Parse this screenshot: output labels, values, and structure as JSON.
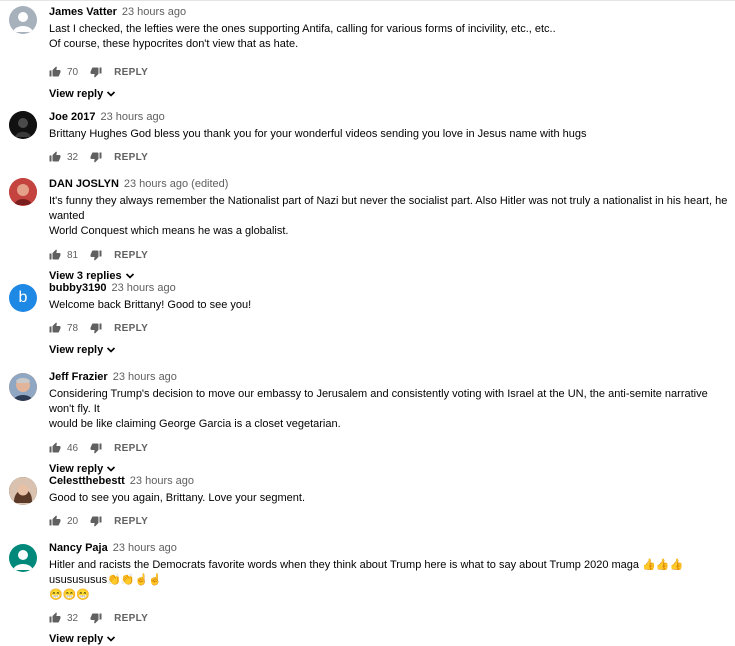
{
  "ui": {
    "reply_label": "REPLY"
  },
  "comments": [
    {
      "author": "James Vatter",
      "time": "23 hours ago",
      "lines": [
        "Last I checked, the lefties were the ones supporting Antifa, calling for various forms of incivility, etc., etc..",
        "Of course, these hypocrites don't view that as hate."
      ],
      "likes": "70",
      "view_replies": "View reply",
      "avatar": {
        "type": "default-person",
        "color": "#a7b1bc"
      }
    },
    {
      "author": "Joe 2017",
      "time": "23 hours ago",
      "lines": [
        "Brittany Hughes God bless you thank you for your wonderful videos sending you love in Jesus name with hugs"
      ],
      "likes": "32",
      "view_replies": "",
      "avatar": {
        "type": "photo-dark",
        "color": "#1d1d1d"
      }
    },
    {
      "author": "DAN JOSLYN",
      "time": "23 hours ago (edited)",
      "lines": [
        "It's funny they always remember the Nationalist part of Nazi but never the socialist part. Also Hitler was not truly a nationalist in his heart, he wanted",
        "World Conquest which means he was a globalist."
      ],
      "likes": "81",
      "view_replies": "View 3 replies",
      "avatar": {
        "type": "photo-red",
        "color": "#b83a3a"
      }
    },
    {
      "author": "bubby3190",
      "time": "23 hours ago",
      "lines": [
        "Welcome back Brittany!  Good to see you!"
      ],
      "likes": "78",
      "view_replies": "View reply",
      "avatar": {
        "type": "letter",
        "letter": "b",
        "color": "#1e88e5"
      }
    },
    {
      "author": "Jeff Frazier",
      "time": "23 hours ago",
      "lines": [
        "Considering Trump's decision to move our embassy to Jerusalem and consistently voting with Israel at the UN, the anti-semite narrative won't fly. It",
        "would be like claiming George Garcia is a closet vegetarian."
      ],
      "likes": "46",
      "view_replies": "View reply",
      "avatar": {
        "type": "photo-man",
        "color": "#b5816a"
      }
    },
    {
      "author": "Celestthebestt",
      "time": "23 hours ago",
      "lines": [
        "Good to see you again, Brittany. Love your segment."
      ],
      "likes": "20",
      "view_replies": "",
      "avatar": {
        "type": "photo-woman",
        "color": "#7a5a44"
      }
    },
    {
      "author": "Nancy Paja",
      "time": "23 hours ago",
      "lines": [
        "Hitler and racists the Democrats favorite words when they think about Trump here is what to say about Trump 2020 maga 👍👍👍ususususus👏👏☝☝",
        "😁😁😁"
      ],
      "likes": "32",
      "view_replies": "View reply",
      "avatar": {
        "type": "default-person",
        "color": "#00897b"
      }
    }
  ]
}
